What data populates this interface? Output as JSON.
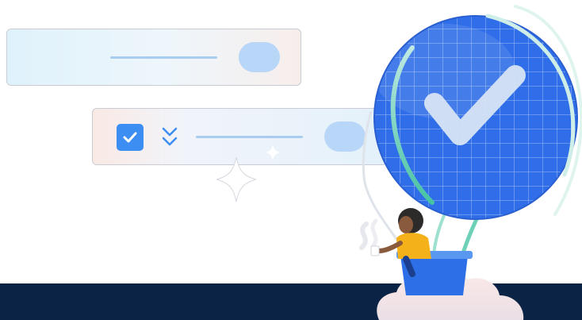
{
  "illustration": {
    "theme": "task-completion",
    "colors": {
      "footer_bg": "#0b2344",
      "accent_blue": "#3d8ef2",
      "globe_blue": "#2f6ee8",
      "pill_blue": "#b8d6f7",
      "line_blue": "#a9cdf0",
      "shirt_yellow": "#f5b11a",
      "basket_blue": "#2c6fe6",
      "cloud_pink": "#f6e0e0"
    },
    "icons": [
      "checkbox-checked-icon",
      "chevron-double-down-icon",
      "checkmark-icon",
      "sparkle-icon"
    ]
  }
}
